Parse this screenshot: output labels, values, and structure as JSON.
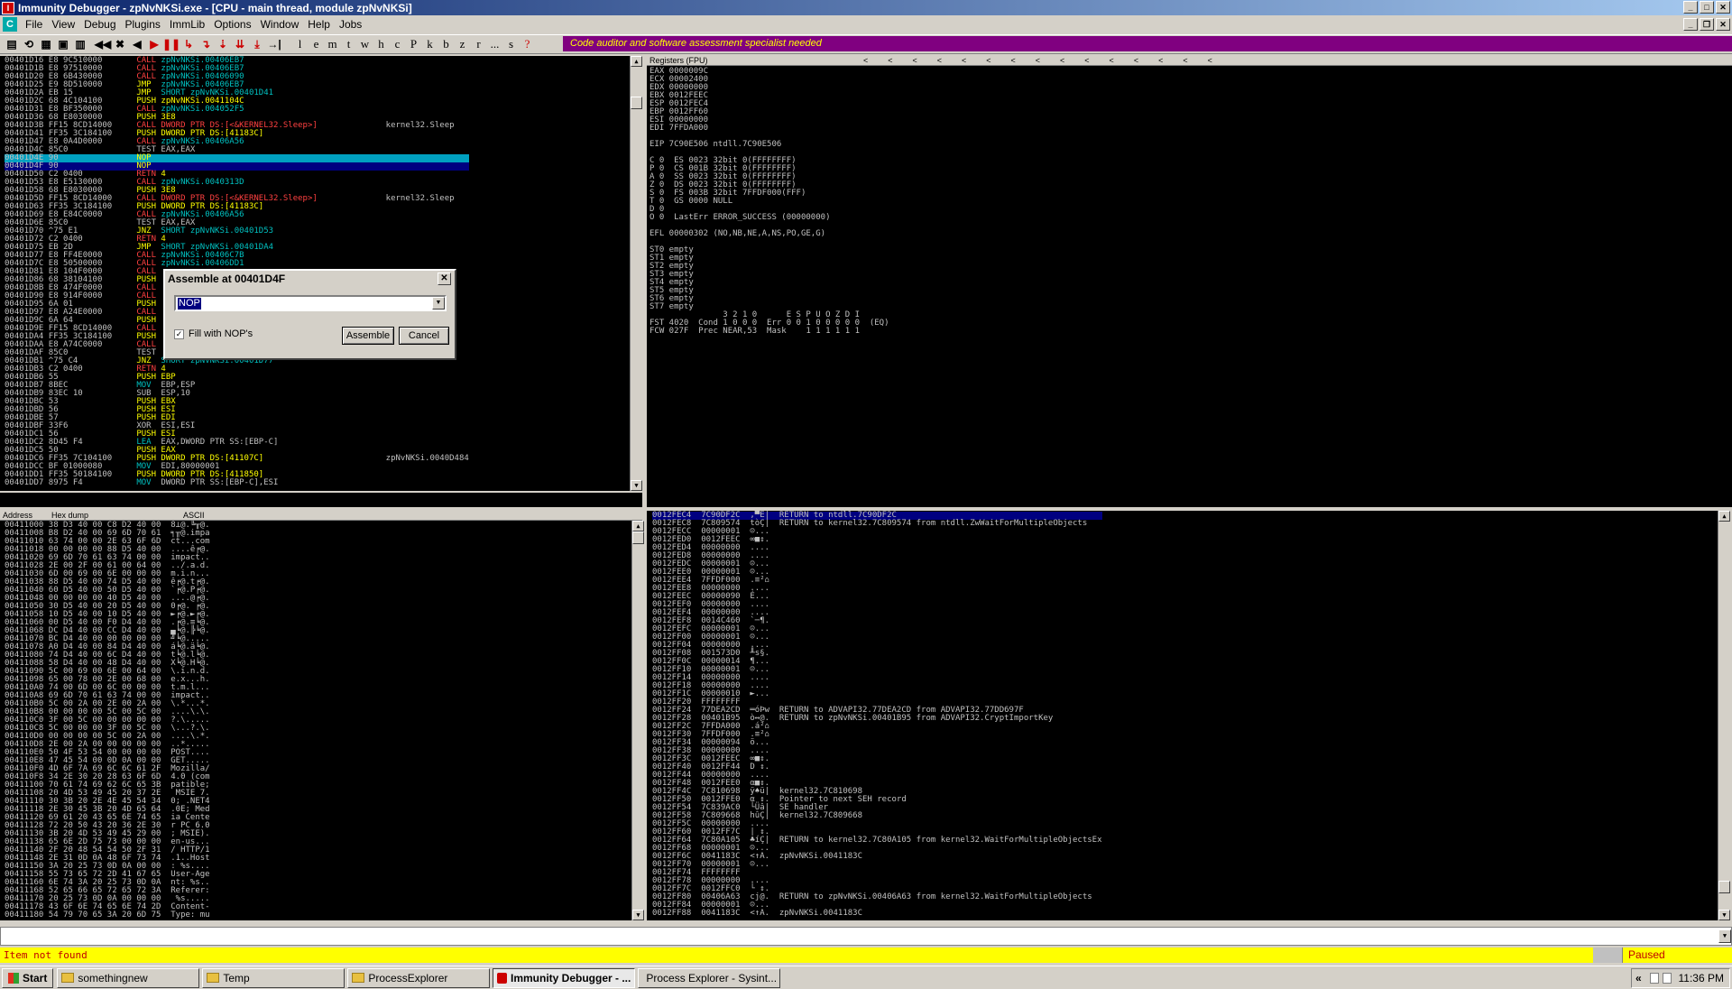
{
  "window": {
    "title": "Immunity Debugger - zpNvNKSi.exe - [CPU - main thread, module zpNvNKSi]"
  },
  "menu": [
    "File",
    "View",
    "Debug",
    "Plugins",
    "ImmLib",
    "Options",
    "Window",
    "Help",
    "Jobs"
  ],
  "toolbar_letters": [
    "l",
    "e",
    "m",
    "t",
    "w",
    "h",
    "c",
    "P",
    "k",
    "b",
    "z",
    "r",
    "...",
    "s",
    "?"
  ],
  "banner": "Code auditor and software assessment specialist needed",
  "disasm": [
    [
      "00401D16",
      "E8 9C510000",
      "CALL",
      "zpNvNKSi.00406EB7",
      ""
    ],
    [
      "00401D1B",
      "E8 97510000",
      "CALL",
      "zpNvNKSi.00406EB7",
      ""
    ],
    [
      "00401D20",
      "E8 6B430000",
      "CALL",
      "zpNvNKSi.00406090",
      ""
    ],
    [
      "00401D25",
      "E9 8D510000",
      "JMP",
      "zpNvNKSi.00406EB7",
      ""
    ],
    [
      "00401D2A",
      "EB 15",
      "JMP",
      "SHORT zpNvNKSi.00401D41",
      ""
    ],
    [
      "00401D2C",
      "68 4C104100",
      "PUSH",
      "zpNvNKSi.0041104C",
      ""
    ],
    [
      "00401D31",
      "E8 BF350000",
      "CALL",
      "zpNvNKSi.004052F5",
      ""
    ],
    [
      "00401D36",
      "68 E8030000",
      "PUSH",
      "3E8",
      ""
    ],
    [
      "00401D3B",
      "FF15 8CD14000",
      "CALL",
      "DWORD PTR DS:[<&KERNEL32.Sleep>]",
      "kernel32.Sleep"
    ],
    [
      "00401D41",
      "FF35 3C184100",
      "PUSH",
      "DWORD PTR DS:[41183C]",
      ""
    ],
    [
      "00401D47",
      "E8 0A4D0000",
      "CALL",
      "zpNvNKSi.00406A56",
      ""
    ],
    [
      "00401D4C",
      "85C0",
      "TEST",
      "EAX,EAX",
      ""
    ],
    [
      "00401D4E",
      "90",
      "NOP",
      "",
      ""
    ],
    [
      "00401D4F",
      "90",
      "NOP",
      "",
      ""
    ],
    [
      "00401D50",
      "C2 0400",
      "RETN",
      "4",
      ""
    ],
    [
      "00401D53",
      "E8 E5130000",
      "CALL",
      "zpNvNKSi.0040313D",
      ""
    ],
    [
      "00401D58",
      "68 E8030000",
      "PUSH",
      "3E8",
      ""
    ],
    [
      "00401D5D",
      "FF15 8CD14000",
      "CALL",
      "DWORD PTR DS:[<&KERNEL32.Sleep>]",
      "kernel32.Sleep"
    ],
    [
      "00401D63",
      "FF35 3C184100",
      "PUSH",
      "DWORD PTR DS:[41183C]",
      ""
    ],
    [
      "00401D69",
      "E8 E84C0000",
      "CALL",
      "zpNvNKSi.00406A56",
      ""
    ],
    [
      "00401D6E",
      "85C0",
      "TEST",
      "EAX,EAX",
      ""
    ],
    [
      "00401D70",
      "^75 E1",
      "JNZ",
      "SHORT zpNvNKSi.00401D53",
      ""
    ],
    [
      "00401D72",
      "C2 0400",
      "RETN",
      "4",
      ""
    ],
    [
      "00401D75",
      "EB 2D",
      "JMP",
      "SHORT zpNvNKSi.00401DA4",
      ""
    ],
    [
      "00401D77",
      "E8 FF4E0000",
      "CALL",
      "zpNvNKSi.00406C7B",
      ""
    ],
    [
      "00401D7C",
      "E8 50500000",
      "CALL",
      "zpNvNKSi.00406DD1",
      ""
    ],
    [
      "00401D81",
      "E8 104F0000",
      "CALL",
      "",
      ""
    ],
    [
      "00401D86",
      "68 38104100",
      "PUSH",
      "",
      ""
    ],
    [
      "00401D8B",
      "E8 474F0000",
      "CALL",
      "",
      ""
    ],
    [
      "00401D90",
      "E8 914F0000",
      "CALL",
      "",
      ""
    ],
    [
      "00401D95",
      "6A 01",
      "PUSH",
      "",
      ""
    ],
    [
      "00401D97",
      "E8 A24E0000",
      "CALL",
      "",
      ""
    ],
    [
      "00401D9C",
      "6A 64",
      "PUSH",
      "",
      ""
    ],
    [
      "00401D9E",
      "FF15 8CD14000",
      "CALL",
      "",
      ""
    ],
    [
      "00401DA4",
      "FF35 3C184100",
      "PUSH",
      "",
      ""
    ],
    [
      "00401DAA",
      "E8 A74C0000",
      "CALL",
      "",
      ""
    ],
    [
      "00401DAF",
      "85C0",
      "TEST",
      "",
      ""
    ],
    [
      "00401DB1",
      "^75 C4",
      "JNZ",
      "SHORT zpNvNKSi.00401D77",
      ""
    ],
    [
      "00401DB3",
      "C2 0400",
      "RETN",
      "4",
      ""
    ],
    [
      "00401DB6",
      "55",
      "PUSH",
      "EBP",
      ""
    ],
    [
      "00401DB7",
      "8BEC",
      "MOV",
      "EBP,ESP",
      ""
    ],
    [
      "00401DB9",
      "83EC 10",
      "SUB",
      "ESP,10",
      ""
    ],
    [
      "00401DBC",
      "53",
      "PUSH",
      "EBX",
      ""
    ],
    [
      "00401DBD",
      "56",
      "PUSH",
      "ESI",
      ""
    ],
    [
      "00401DBE",
      "57",
      "PUSH",
      "EDI",
      ""
    ],
    [
      "00401DBF",
      "33F6",
      "XOR",
      "ESI,ESI",
      ""
    ],
    [
      "00401DC1",
      "56",
      "PUSH",
      "ESI",
      ""
    ],
    [
      "00401DC2",
      "8D45 F4",
      "LEA",
      "EAX,DWORD PTR SS:[EBP-C]",
      ""
    ],
    [
      "00401DC5",
      "50",
      "PUSH",
      "EAX",
      ""
    ],
    [
      "00401DC6",
      "FF35 7C104100",
      "PUSH",
      "DWORD PTR DS:[41107C]",
      "zpNvNKSi.0040D484"
    ],
    [
      "00401DCC",
      "BF 01000080",
      "MOV",
      "EDI,80000001",
      ""
    ],
    [
      "00401DD1",
      "FF35 50184100",
      "PUSH",
      "DWORD PTR DS:[411850]",
      ""
    ],
    [
      "00401DD7",
      "8975 F4",
      "MOV",
      "DWORD PTR SS:[EBP-C],ESI",
      ""
    ]
  ],
  "registers_header": "Registers (FPU)",
  "registers": [
    "EAX 0000009C",
    "ECX 00002400",
    "EDX 00000000",
    "EBX 0012FEEC",
    "ESP 0012FEC4",
    "EBP 0012FF60",
    "ESI 00000000",
    "EDI 7FFDA000",
    "",
    "EIP 7C90E506 ntdll.7C90E506",
    "",
    "C 0  ES 0023 32bit 0(FFFFFFFF)",
    "P 0  CS 001B 32bit 0(FFFFFFFF)",
    "A 0  SS 0023 32bit 0(FFFFFFFF)",
    "Z 0  DS 0023 32bit 0(FFFFFFFF)",
    "S 0  FS 003B 32bit 7FFDF000(FFF)",
    "T 0  GS 0000 NULL",
    "D 0",
    "O 0  LastErr ERROR_SUCCESS (00000000)",
    "",
    "EFL 00000302 (NO,NB,NE,A,NS,PO,GE,G)",
    "",
    "ST0 empty",
    "ST1 empty",
    "ST2 empty",
    "ST3 empty",
    "ST4 empty",
    "ST5 empty",
    "ST6 empty",
    "ST7 empty",
    "               3 2 1 0      E S P U O Z D I",
    "FST 4020  Cond 1 0 0 0  Err 0 0 1 0 0 0 0 0  (EQ)",
    "FCW 027F  Prec NEAR,53  Mask    1 1 1 1 1 1"
  ],
  "dump_headers": [
    "Address",
    "Hex dump",
    "ASCII"
  ],
  "dump": [
    [
      "00411000",
      "38 D3 40 00 C8 D2 40 00",
      "8⊥@.╚╥@."
    ],
    [
      "00411008",
      "B8 D2 40 00 69 6D 70 61",
      "╕╥@.impa"
    ],
    [
      "00411010",
      "63 74 00 00 2E 63 6F 6D",
      "ct...com"
    ],
    [
      "00411018",
      "00 00 00 00 88 D5 40 00",
      "....ê╒@."
    ],
    [
      "00411020",
      "69 6D 70 61 63 74 00 00",
      "impact.."
    ],
    [
      "00411028",
      "2E 00 2F 00 61 00 64 00",
      "../.a.d."
    ],
    [
      "00411030",
      "6D 00 69 00 6E 00 00 00",
      "m.i.n..."
    ],
    [
      "00411038",
      "88 D5 40 00 74 D5 40 00",
      "ê╒@.t╒@."
    ],
    [
      "00411040",
      "60 D5 40 00 50 D5 40 00",
      "`╒@.P╒@."
    ],
    [
      "00411048",
      "00 00 00 00 40 D5 40 00",
      "....@╒@."
    ],
    [
      "00411050",
      "30 D5 40 00 20 D5 40 00",
      "0╒@. ╒@."
    ],
    [
      "00411058",
      "10 D5 40 00 10 D5 40 00",
      "►╒@.►╒@."
    ],
    [
      "00411060",
      "00 D5 40 00 F0 D4 40 00",
      ".╒@.≡╘@."
    ],
    [
      "00411068",
      "DC D4 40 00 CC D4 40 00",
      "▄╘@.╠╘@."
    ],
    [
      "00411070",
      "BC D4 40 00 00 00 00 00",
      "╝╘@....."
    ],
    [
      "00411078",
      "A0 D4 40 00 84 D4 40 00",
      "á╘@.ä╘@."
    ],
    [
      "00411080",
      "74 D4 40 00 6C D4 40 00",
      "t╘@.l╘@."
    ],
    [
      "00411088",
      "58 D4 40 00 48 D4 40 00",
      "X╘@.H╘@."
    ],
    [
      "00411090",
      "5C 00 69 00 6E 00 64 00",
      "\\.i.n.d."
    ],
    [
      "00411098",
      "65 00 78 00 2E 00 68 00",
      "e.x...h."
    ],
    [
      "004110A0",
      "74 00 6D 00 6C 00 00 00",
      "t.m.l..."
    ],
    [
      "004110A8",
      "69 6D 70 61 63 74 00 00",
      "impact.."
    ],
    [
      "004110B0",
      "5C 00 2A 00 2E 00 2A 00",
      "\\.*...*."
    ],
    [
      "004110B8",
      "00 00 00 00 5C 00 5C 00",
      "....\\.\\."
    ],
    [
      "004110C0",
      "3F 00 5C 00 00 00 00 00",
      "?.\\....."
    ],
    [
      "004110C8",
      "5C 00 00 00 3F 00 5C 00",
      "\\...?.\\."
    ],
    [
      "004110D0",
      "00 00 00 00 5C 00 2A 00",
      "....\\.*."
    ],
    [
      "004110D8",
      "2E 00 2A 00 00 00 00 00",
      "..*....."
    ],
    [
      "004110E0",
      "50 4F 53 54 00 00 00 00",
      "POST...."
    ],
    [
      "004110E8",
      "47 45 54 00 0D 0A 00 00",
      "GET....."
    ],
    [
      "004110F0",
      "4D 6F 7A 69 6C 6C 61 2F",
      "Mozilla/"
    ],
    [
      "004110F8",
      "34 2E 30 20 28 63 6F 6D",
      "4.0 (com"
    ],
    [
      "00411100",
      "70 61 74 69 62 6C 65 3B",
      "patible;"
    ],
    [
      "00411108",
      "20 4D 53 49 45 20 37 2E",
      " MSIE 7."
    ],
    [
      "00411110",
      "30 3B 20 2E 4E 45 54 34",
      "0; .NET4"
    ],
    [
      "00411118",
      "2E 30 45 3B 20 4D 65 64",
      ".0E; Med"
    ],
    [
      "00411120",
      "69 61 20 43 65 6E 74 65",
      "ia Cente"
    ],
    [
      "00411128",
      "72 20 50 43 20 36 2E 30",
      "r PC 6.0"
    ],
    [
      "00411130",
      "3B 20 4D 53 49 45 29 00",
      "; MSIE)."
    ],
    [
      "00411138",
      "65 6E 2D 75 73 00 00 00",
      "en-us..."
    ],
    [
      "00411140",
      "2F 20 48 54 54 50 2F 31",
      "/ HTTP/1"
    ],
    [
      "00411148",
      "2E 31 0D 0A 48 6F 73 74",
      ".1..Host"
    ],
    [
      "00411150",
      "3A 20 25 73 0D 0A 00 00",
      ": %s...."
    ],
    [
      "00411158",
      "55 73 65 72 2D 41 67 65",
      "User-Age"
    ],
    [
      "00411160",
      "6E 74 3A 20 25 73 0D 0A",
      "nt: %s.."
    ],
    [
      "00411168",
      "52 65 66 65 72 65 72 3A",
      "Referer:"
    ],
    [
      "00411170",
      "20 25 73 0D 0A 00 00 00",
      " %s....."
    ],
    [
      "00411178",
      "43 6F 6E 74 65 6E 74 2D",
      "Content-"
    ],
    [
      "00411180",
      "54 79 70 65 3A 20 6D 75",
      "Type: mu"
    ]
  ],
  "stack": [
    [
      "0012FEC4",
      "7C90DF2C",
      ",▀É|",
      "RETURN to ntdll.7C90DF2C"
    ],
    [
      "0012FEC8",
      "7C809574",
      "tòÇ|",
      "RETURN to kernel32.7C809574 from ntdll.ZwWaitForMultipleObjects"
    ],
    [
      "0012FECC",
      "00000001",
      "☺...",
      ""
    ],
    [
      "0012FED0",
      "0012FEEC",
      "∞■↕.",
      ""
    ],
    [
      "0012FED4",
      "00000000",
      "....",
      ""
    ],
    [
      "0012FED8",
      "00000000",
      "....",
      ""
    ],
    [
      "0012FEDC",
      "00000001",
      "☺...",
      ""
    ],
    [
      "0012FEE0",
      "00000001",
      "☺...",
      ""
    ],
    [
      "0012FEE4",
      "7FFDF000",
      ".≡²⌂",
      ""
    ],
    [
      "0012FEE8",
      "00000000",
      "....",
      ""
    ],
    [
      "0012FEEC",
      "00000090",
      "É...",
      ""
    ],
    [
      "0012FEF0",
      "00000000",
      "....",
      ""
    ],
    [
      "0012FEF4",
      "00000000",
      "....",
      ""
    ],
    [
      "0012FEF8",
      "0014C460",
      "`─¶.",
      ""
    ],
    [
      "0012FEFC",
      "00000001",
      "☺...",
      ""
    ],
    [
      "0012FF00",
      "00000001",
      "☺...",
      ""
    ],
    [
      "0012FF04",
      "00000000",
      "....",
      ""
    ],
    [
      "0012FF08",
      "001573D0",
      "╨s§.",
      ""
    ],
    [
      "0012FF0C",
      "00000014",
      "¶...",
      ""
    ],
    [
      "0012FF10",
      "00000001",
      "☺...",
      ""
    ],
    [
      "0012FF14",
      "00000000",
      "....",
      ""
    ],
    [
      "0012FF18",
      "00000000",
      "....",
      ""
    ],
    [
      "0012FF1C",
      "00000010",
      "►...",
      ""
    ],
    [
      "0012FF20",
      "FFFFFFFF",
      "    ",
      ""
    ],
    [
      "0012FF24",
      "77DEA2CD",
      "═óÞw",
      "RETURN to ADVAPI32.77DEA2CD from ADVAPI32.77DD697F"
    ],
    [
      "0012FF28",
      "00401B95",
      "ò↔@.",
      "RETURN to zpNvNKSi.00401B95 from ADVAPI32.CryptImportKey"
    ],
    [
      "0012FF2C",
      "7FFDA000",
      ".á²⌂",
      ""
    ],
    [
      "0012FF30",
      "7FFDF000",
      ".≡²⌂",
      ""
    ],
    [
      "0012FF34",
      "00000094",
      "ö...",
      ""
    ],
    [
      "0012FF38",
      "00000000",
      "....",
      ""
    ],
    [
      "0012FF3C",
      "0012FEEC",
      "∞■↕.",
      ""
    ],
    [
      "0012FF40",
      "0012FF44",
      "D ↕.",
      ""
    ],
    [
      "0012FF44",
      "00000000",
      "....",
      ""
    ],
    [
      "0012FF48",
      "0012FEE0",
      "α■↕.",
      ""
    ],
    [
      "0012FF4C",
      "7C810698",
      "ÿ♠ü|",
      "kernel32.7C810698"
    ],
    [
      "0012FF50",
      "0012FFE0",
      "α ↕.",
      "Pointer to next SEH record"
    ],
    [
      "0012FF54",
      "7C839AC0",
      "└Üâ|",
      "SE handler"
    ],
    [
      "0012FF58",
      "7C809668",
      "hûÇ|",
      "kernel32.7C809668"
    ],
    [
      "0012FF5C",
      "00000000",
      "....",
      ""
    ],
    [
      "0012FF60",
      "0012FF7C",
      "| ↕.",
      ""
    ],
    [
      "0012FF64",
      "7C80A105",
      "♣íÇ|",
      "RETURN to kernel32.7C80A105 from kernel32.WaitForMultipleObjectsEx"
    ],
    [
      "0012FF68",
      "00000001",
      "☺...",
      ""
    ],
    [
      "0012FF6C",
      "0041183C",
      "<↑A.",
      "zpNvNKSi.0041183C"
    ],
    [
      "0012FF70",
      "00000001",
      "☺...",
      ""
    ],
    [
      "0012FF74",
      "FFFFFFFF",
      "    ",
      ""
    ],
    [
      "0012FF78",
      "00000000",
      "....",
      ""
    ],
    [
      "0012FF7C",
      "0012FFC0",
      "└ ↕.",
      ""
    ],
    [
      "0012FF80",
      "00406A63",
      "cj@.",
      "RETURN to zpNvNKSi.00406A63 from kernel32.WaitForMultipleObjects"
    ],
    [
      "0012FF84",
      "00000001",
      "☺...",
      ""
    ],
    [
      "0012FF88",
      "0041183C",
      "<↑A.",
      "zpNvNKSi.0041183C"
    ]
  ],
  "dialog": {
    "title": "Assemble at 00401D4F",
    "input_value": "NOP",
    "checkbox_label": "Fill with NOP's",
    "assemble_label": "Assemble",
    "cancel_label": "Cancel"
  },
  "status": {
    "message": "Item not found",
    "state": "Paused"
  },
  "taskbar": {
    "start": "Start",
    "tasks": [
      "somethingnew",
      "Temp",
      "ProcessExplorer",
      "Immunity Debugger - ...",
      "Process Explorer - Sysint..."
    ],
    "clock": "11:36 PM"
  }
}
